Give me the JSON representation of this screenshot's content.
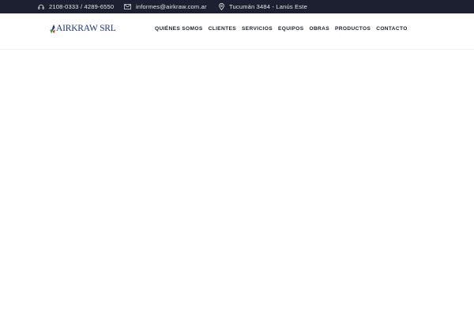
{
  "topbar": {
    "phone": "2108-0333 / 4289-6550",
    "email": "informes@airkraw.com.ar",
    "address": "Tucumán 3484 - Lanús Este"
  },
  "header": {
    "logo_text": "AIRKRAW SRL"
  },
  "nav": {
    "items": [
      {
        "label": "QUIÉNES SOMOS"
      },
      {
        "label": "CLIENTES"
      },
      {
        "label": "SERVICIOS"
      },
      {
        "label": "EQUIPOS"
      },
      {
        "label": "OBRAS"
      },
      {
        "label": "PRODUCTOS"
      },
      {
        "label": "CONTACTO"
      }
    ]
  },
  "colors": {
    "topbar_bg": "#1d2030",
    "brand_blue": "#22367a",
    "logo_accent_green": "#3a9a3e",
    "logo_accent_red": "#d8302e"
  },
  "icons": {
    "phone": "headset-icon",
    "email": "envelope-icon",
    "address": "map-pin-icon"
  }
}
